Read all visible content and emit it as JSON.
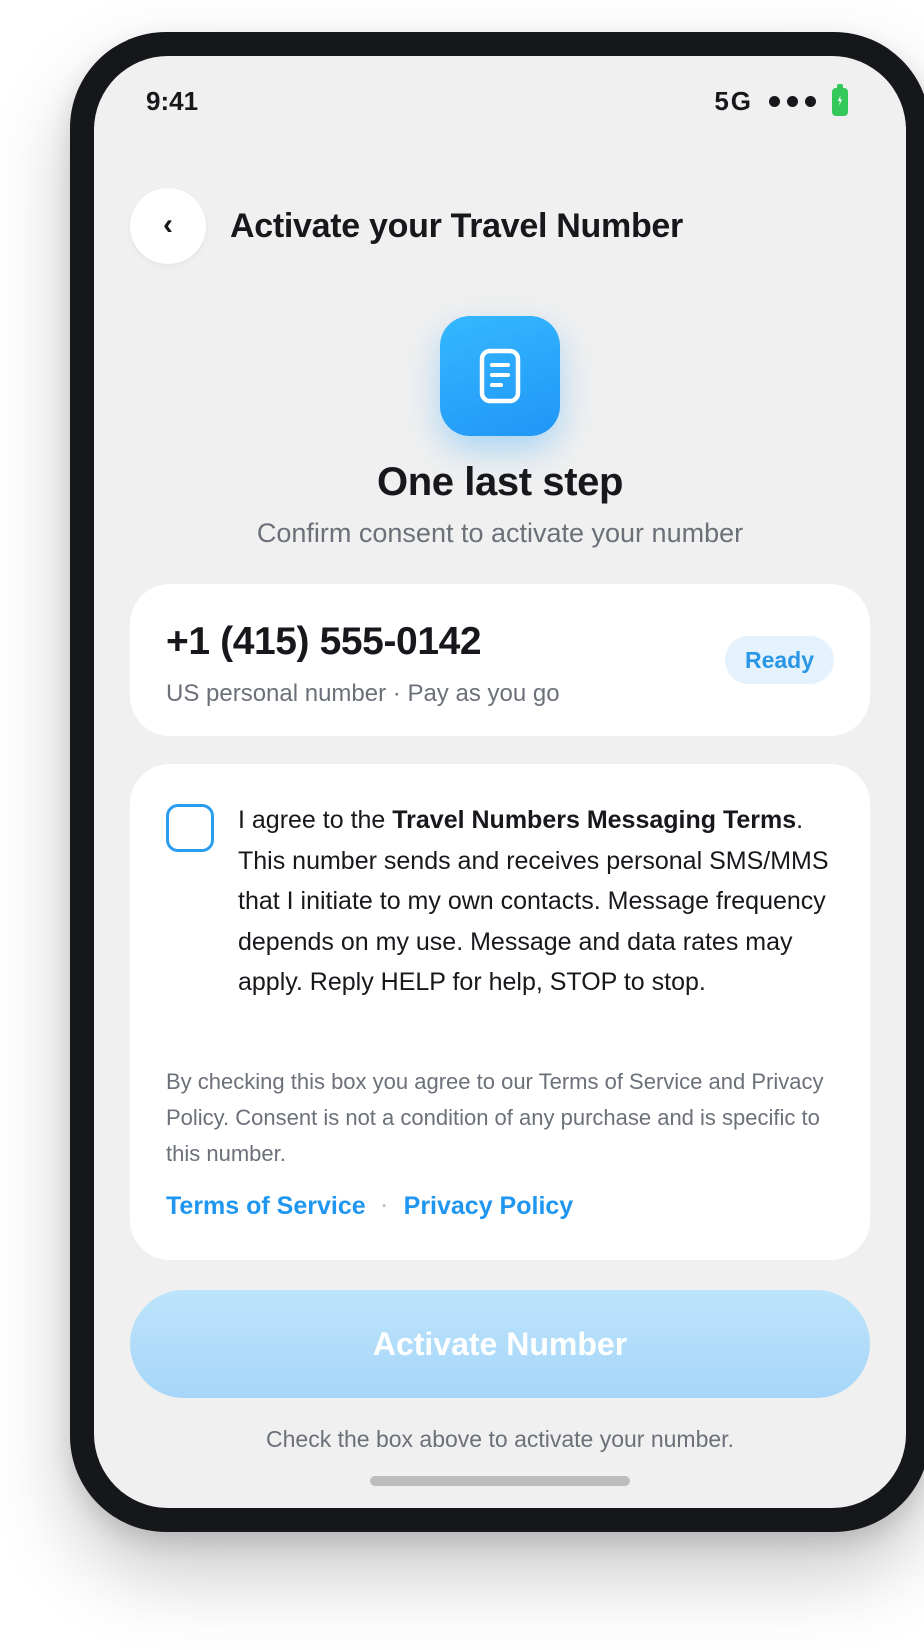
{
  "status_bar": {
    "time": "9:41",
    "network": "5G",
    "signal_icon": "signal-dots-icon",
    "battery_icon": "battery-charging-icon"
  },
  "header": {
    "back_label": "‹",
    "title": "Activate your Travel Number"
  },
  "hero": {
    "icon": "document-icon",
    "title": "One last step",
    "subtitle": "Confirm consent to activate your number"
  },
  "number_card": {
    "number": "+1 (415) 555-0142",
    "description": "US personal number · Pay as you go",
    "badge": "Ready"
  },
  "consent": {
    "checked": false,
    "text_prefix": "I agree to the ",
    "terms_name": "Travel Numbers Messaging Terms",
    "text_suffix": ". This number sends and receives personal SMS/MMS that I initiate to my own contacts. Message frequency depends on my use. Message and data rates may apply. Reply HELP for help, STOP to stop.",
    "fineprint": "By checking this box you agree to our Terms of Service and Privacy Policy. Consent is not a condition of any purchase and is specific to this number.",
    "links": {
      "terms": "Terms of Service",
      "separator": "·",
      "privacy": "Privacy Policy"
    }
  },
  "activate_button": {
    "label": "Activate Number",
    "enabled": false
  },
  "helper_text": "Check the box above to activate your number.",
  "colors": {
    "accent": "#1f96f0",
    "badge_bg": "#e4f2fd",
    "button_disabled": "#a6d6f8",
    "screen_bg": "#f0f0f0",
    "device_frame": "#15171b"
  }
}
